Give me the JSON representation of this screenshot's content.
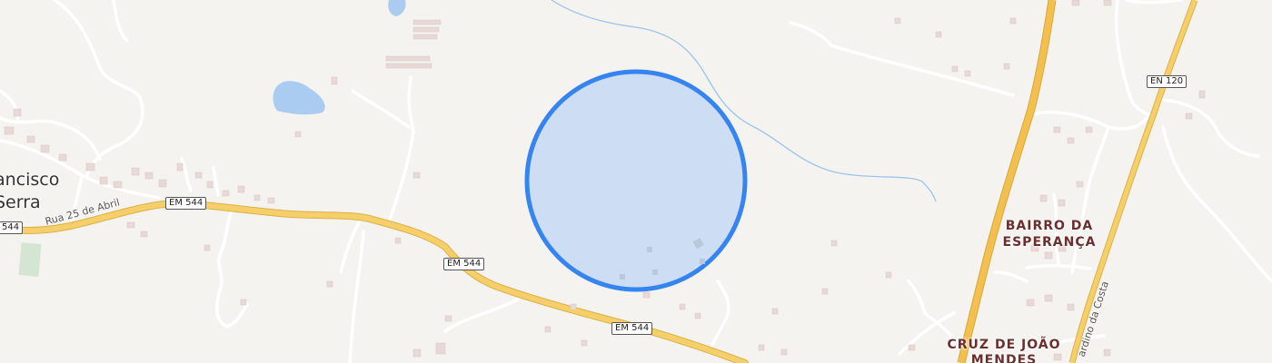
{
  "map": {
    "places": [
      {
        "id": "bairro",
        "line1": "BAIRRO DA",
        "line2": "ESPERANÇA"
      },
      {
        "id": "cruz",
        "line1": "CRUZ DE JOÃO",
        "line2": "MENDES"
      }
    ],
    "town": {
      "line1": "ancisco",
      "line2": "Serra"
    },
    "streets": {
      "rua_25_abril": "Rua 25 de Abril",
      "bernardino": "ardino da Costa"
    },
    "shields": {
      "em544_a": "EM 544",
      "em544_b": "EM 544",
      "em544_c": "EM 544",
      "em544_left": "544",
      "en120": "EN 120"
    },
    "colors": {
      "background": "#f5f3ef",
      "water": "#a9ccf0",
      "major_road": "#f6cf6a",
      "highway": "#f3c04f",
      "minor_road": "#ffffff",
      "selection_fill": "#c8dbf4",
      "selection_stroke": "#3684f0",
      "place_label": "#6b2f2f"
    }
  }
}
